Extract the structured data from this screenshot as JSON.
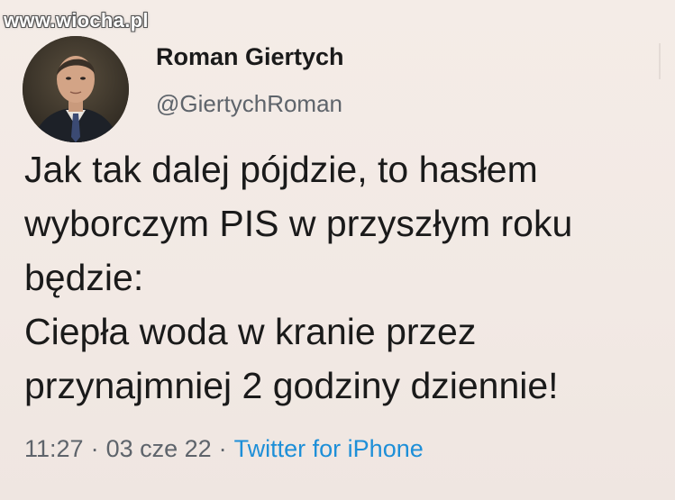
{
  "watermark": "www.wiocha.pl",
  "author": {
    "name": "Roman Giertych",
    "handle": "@GiertychRoman"
  },
  "tweet": {
    "text": "Jak tak dalej pójdzie, to hasłem\nwyborczym PIS w przyszłym roku\nbędzie:\nCiepła woda w kranie przez\nprzynajmniej 2 godziny dziennie!",
    "time": "11:27",
    "separator": "·",
    "date": "03 cze 22",
    "source": "Twitter for iPhone"
  },
  "colors": {
    "background": "#f3ebe6",
    "text": "#1a1a1a",
    "muted": "#5e646b",
    "link": "#1d8fd8"
  },
  "icons": {
    "avatar": "profile-photo",
    "more": "more-icon"
  }
}
